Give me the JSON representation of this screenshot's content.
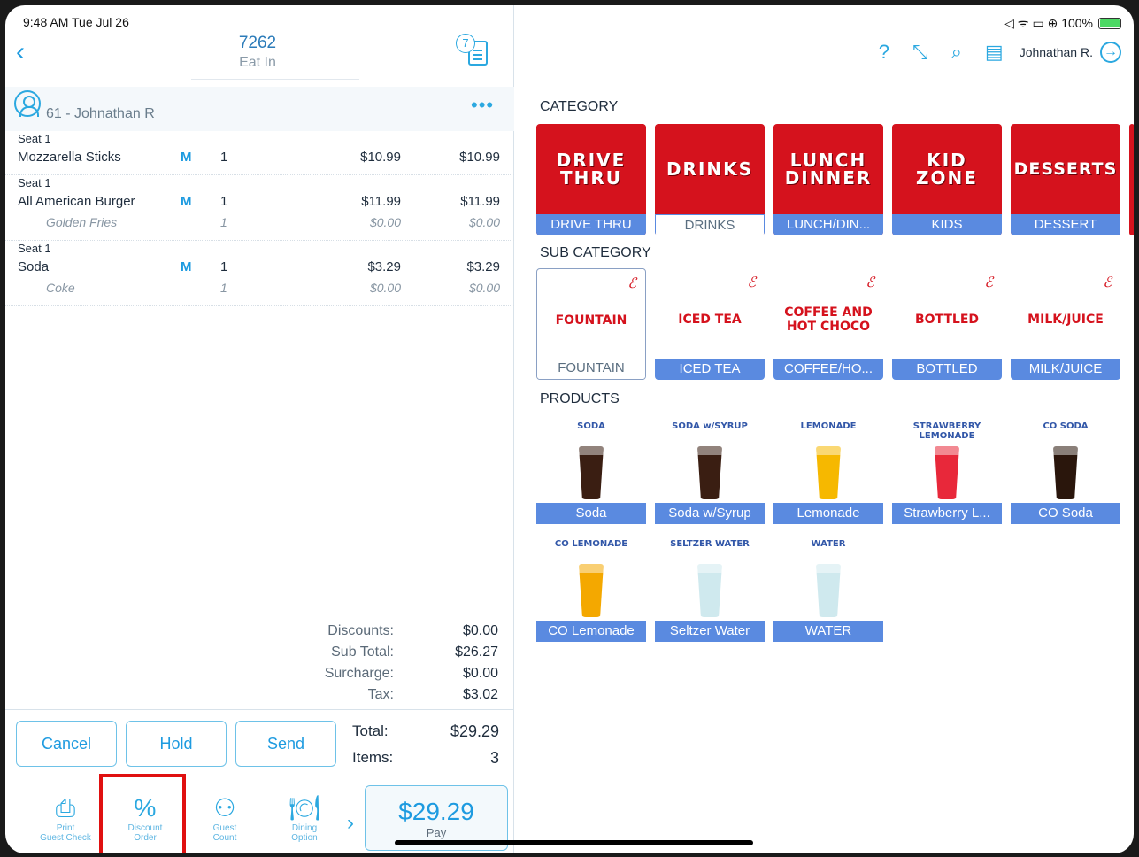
{
  "status": {
    "time": "9:48 AM  Tue Jul 26",
    "indicators": "◁ ᯤ ▭ ⊕ 100%"
  },
  "header": {
    "order_number": "7262",
    "order_type": "Eat In",
    "seat_count": "7"
  },
  "customer": {
    "name": "61 - Johnathan R"
  },
  "order_groups": [
    {
      "seat": "Seat 1",
      "item": {
        "name": "Mozzarella Sticks",
        "mod": "M",
        "qty": "1",
        "price": "$10.99",
        "total": "$10.99"
      },
      "subs": []
    },
    {
      "seat": "Seat 1",
      "item": {
        "name": "All American Burger",
        "mod": "M",
        "qty": "1",
        "price": "$11.99",
        "total": "$11.99"
      },
      "subs": [
        {
          "name": "Golden Fries",
          "qty": "1",
          "price": "$0.00",
          "total": "$0.00"
        }
      ]
    },
    {
      "seat": "Seat 1",
      "item": {
        "name": "Soda",
        "mod": "M",
        "qty": "1",
        "price": "$3.29",
        "total": "$3.29"
      },
      "subs": [
        {
          "name": "Coke",
          "qty": "1",
          "price": "$0.00",
          "total": "$0.00"
        }
      ]
    }
  ],
  "totals": {
    "discounts_label": "Discounts:",
    "discounts": "$0.00",
    "subtotal_label": "Sub Total:",
    "subtotal": "$26.27",
    "surcharge_label": "Surcharge:",
    "surcharge": "$0.00",
    "tax_label": "Tax:",
    "tax": "$3.02",
    "total_label": "Total:",
    "total": "$29.29",
    "items_label": "Items:",
    "items": "3"
  },
  "actions": {
    "cancel": "Cancel",
    "hold": "Hold",
    "send": "Send"
  },
  "toolbar": {
    "print": "Print\nGuest Check",
    "discount": "Discount\nOrder",
    "guest": "Guest\nCount",
    "dining": "Dining\nOption",
    "pay_amount": "$29.29",
    "pay_label": "Pay"
  },
  "topbar": {
    "help": "?",
    "user": "Johnathan R."
  },
  "sections": {
    "category": "CATEGORY",
    "sub_category": "SUB CATEGORY",
    "products": "PRODUCTS"
  },
  "categories": [
    {
      "art": "DRIVE\nTHRU",
      "label": "DRIVE THRU"
    },
    {
      "art": "DRINKS",
      "label": "DRINKS"
    },
    {
      "art": "LUNCH\nDINNER",
      "label": "LUNCH/DIN..."
    },
    {
      "art": "KID\nZONE",
      "label": "KIDS"
    },
    {
      "art": "DESSERTS",
      "label": "DESSERT"
    }
  ],
  "sub_categories": [
    {
      "art": "FOUNTAIN",
      "label": "FOUNTAIN"
    },
    {
      "art": "ICED TEA",
      "label": "ICED TEA"
    },
    {
      "art": "COFFEE AND\nHOT CHOCO",
      "label": "COFFEE/HO..."
    },
    {
      "art": "BOTTLED",
      "label": "BOTTLED"
    },
    {
      "art": "MILK/JUICE",
      "label": "MILK/JUICE"
    }
  ],
  "products": [
    {
      "art": "SODA",
      "label": "Soda",
      "color": "#3a1e12"
    },
    {
      "art": "SODA w/SYRUP",
      "label": "Soda w/Syrup",
      "color": "#3a1e12"
    },
    {
      "art": "LEMONADE",
      "label": "Lemonade",
      "color": "#f6b800"
    },
    {
      "art": "STRAWBERRY\nLEMONADE",
      "label": "Strawberry L...",
      "color": "#e8283a"
    },
    {
      "art": "CO SODA",
      "label": "CO Soda",
      "color": "#2a160c"
    },
    {
      "art": "CO LEMONADE",
      "label": "CO Lemonade",
      "color": "#f4a800"
    },
    {
      "art": "SELTZER WATER",
      "label": "Seltzer Water",
      "color": "#cfe9ee"
    },
    {
      "art": "WATER",
      "label": "WATER",
      "color": "#cfe9ee"
    }
  ],
  "colors": {
    "accent": "#1e9be0",
    "tile_red": "#d5121d",
    "caption_blue": "#5a8ae0",
    "highlight": "#e01010"
  }
}
